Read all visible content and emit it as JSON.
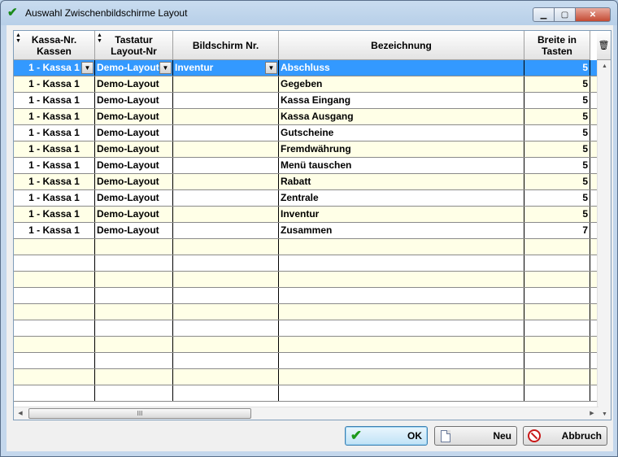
{
  "window": {
    "title": "Auswahl Zwischenbildschirme Layout",
    "minimize": "▭",
    "maximize": "▢",
    "close": "✕"
  },
  "grid": {
    "columns": [
      {
        "key": "kasse",
        "label": "Kassa-Nr.\nKassen",
        "sortable": true
      },
      {
        "key": "layout",
        "label": "Tastatur\nLayout-Nr",
        "sortable": true
      },
      {
        "key": "bildschirm",
        "label": "Bildschirm Nr.",
        "sortable": false
      },
      {
        "key": "bezeichnung",
        "label": "Bezeichnung",
        "sortable": false
      },
      {
        "key": "breite",
        "label": "Breite in\nTasten",
        "sortable": false
      }
    ],
    "rows": [
      {
        "kasse": "1 - Kassa 1",
        "layout": "Demo-Layout",
        "bildschirm": "Inventur",
        "bezeichnung": "Abschluss",
        "breite": "5"
      },
      {
        "kasse": "1 - Kassa 1",
        "layout": "Demo-Layout",
        "bildschirm": "",
        "bezeichnung": "Gegeben",
        "breite": "5"
      },
      {
        "kasse": "1 - Kassa 1",
        "layout": "Demo-Layout",
        "bildschirm": "",
        "bezeichnung": "Kassa Eingang",
        "breite": "5"
      },
      {
        "kasse": "1 - Kassa 1",
        "layout": "Demo-Layout",
        "bildschirm": "",
        "bezeichnung": "Kassa Ausgang",
        "breite": "5"
      },
      {
        "kasse": "1 - Kassa 1",
        "layout": "Demo-Layout",
        "bildschirm": "",
        "bezeichnung": "Gutscheine",
        "breite": "5"
      },
      {
        "kasse": "1 - Kassa 1",
        "layout": "Demo-Layout",
        "bildschirm": "",
        "bezeichnung": "Fremdwährung",
        "breite": "5"
      },
      {
        "kasse": "1 - Kassa 1",
        "layout": "Demo-Layout",
        "bildschirm": "",
        "bezeichnung": "Menü tauschen",
        "breite": "5"
      },
      {
        "kasse": "1 - Kassa 1",
        "layout": "Demo-Layout",
        "bildschirm": "",
        "bezeichnung": "Rabatt",
        "breite": "5"
      },
      {
        "kasse": "1 - Kassa 1",
        "layout": "Demo-Layout",
        "bildschirm": "",
        "bezeichnung": "Zentrale",
        "breite": "5"
      },
      {
        "kasse": "1 - Kassa 1",
        "layout": "Demo-Layout",
        "bildschirm": "",
        "bezeichnung": "Inventur",
        "breite": "5"
      },
      {
        "kasse": "1 - Kassa 1",
        "layout": "Demo-Layout",
        "bildschirm": "",
        "bezeichnung": "Zusammen",
        "breite": "7"
      }
    ],
    "selected_row": 0,
    "hscroll_grip": "III"
  },
  "buttons": {
    "ok": "OK",
    "neu": "Neu",
    "abbruch": "Abbruch"
  },
  "colors": {
    "selection": "#3399ff",
    "row_alt": "#ffffe7"
  }
}
